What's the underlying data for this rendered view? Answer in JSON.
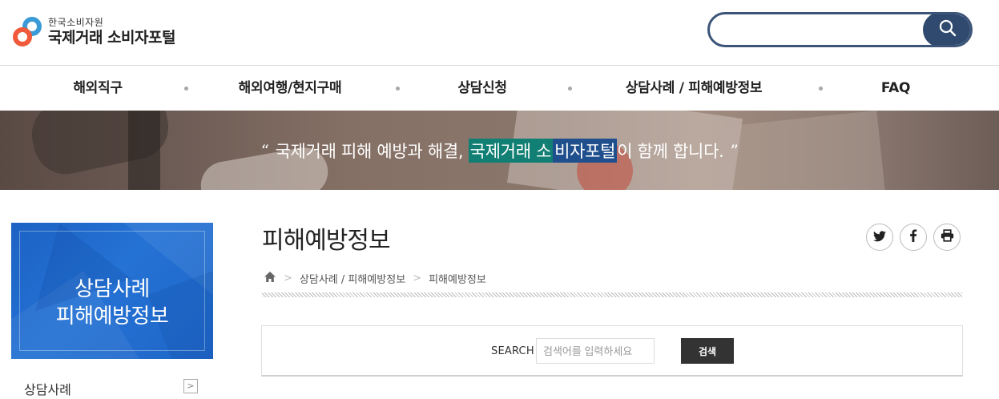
{
  "header": {
    "org_name": "한국소비자원",
    "portal_name": "국제거래 소비자포털",
    "search": {
      "value": "",
      "placeholder": ""
    }
  },
  "nav": {
    "items": [
      {
        "label": "해외직구"
      },
      {
        "label": "해외여행/현지구매"
      },
      {
        "label": "상담신청"
      },
      {
        "label": "상담사례 / 피해예방정보"
      },
      {
        "label": "FAQ"
      }
    ]
  },
  "banner": {
    "open_quote": "“",
    "text_before": "국제거래 피해 예방과 해결,",
    "highlight_a": "국제거래 소",
    "highlight_b": "비자포털",
    "text_after": "이 함께 합니다.",
    "close_quote": "”"
  },
  "sidebar": {
    "title_line1": "상담사례",
    "title_line2": "피해예방정보",
    "menu": [
      {
        "label": "상담사례",
        "arrow": ">"
      }
    ]
  },
  "content": {
    "page_title": "피해예방정보",
    "share": {
      "twitter": "twitter-icon",
      "facebook": "facebook-icon",
      "print": "print-icon"
    },
    "breadcrumb": {
      "home_icon": "home-icon",
      "items": [
        "상담사례 / 피해예방정보",
        "피해예방정보"
      ],
      "separator": ">"
    },
    "search_panel": {
      "label": "SEARCH",
      "placeholder": "검색어를 입력하세요",
      "button": "검색"
    }
  },
  "colors": {
    "accent_navy": "#2f4a6e",
    "sidebar_blue": "#1f66c8",
    "banner_highlight_green": "#117f73",
    "banner_highlight_blue": "#1f4f8c"
  }
}
